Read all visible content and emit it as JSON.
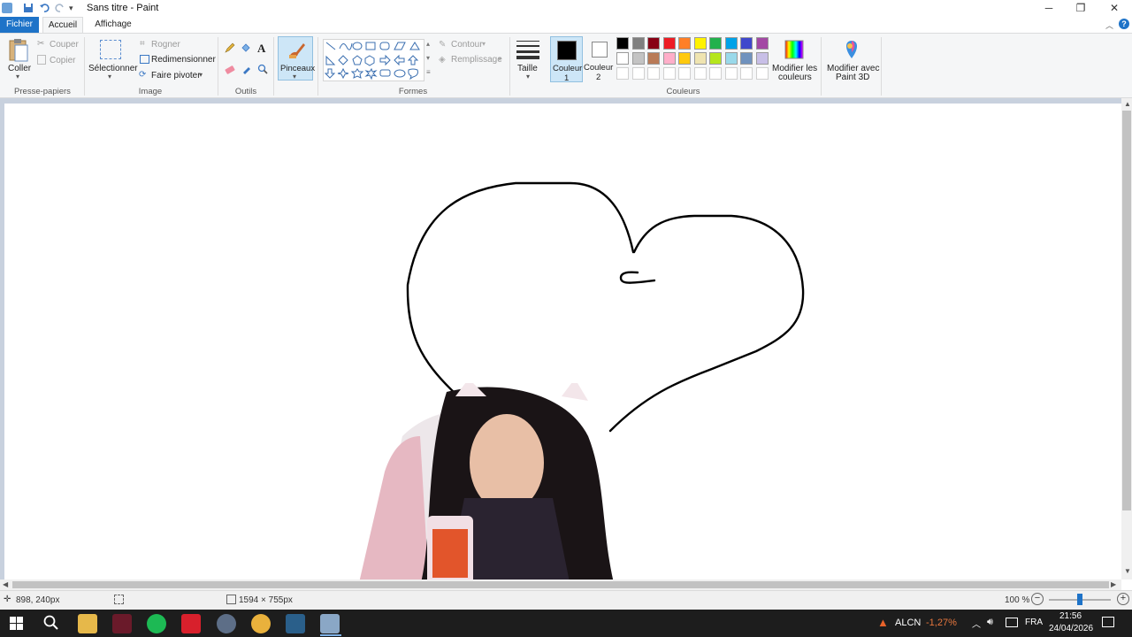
{
  "window": {
    "title": "Sans titre - Paint",
    "minimize_glyph": "─",
    "restore_glyph": "❐",
    "close_glyph": "✕"
  },
  "tabs": {
    "file": "Fichier",
    "home": "Accueil",
    "view": "Affichage"
  },
  "clipboard": {
    "paste": "Coller",
    "cut": "Couper",
    "copy": "Copier",
    "group": "Presse-papiers"
  },
  "image": {
    "select": "Sélectionner",
    "crop": "Rogner",
    "resize": "Redimensionner",
    "rotate": "Faire pivoter",
    "group": "Image"
  },
  "tools": {
    "group": "Outils",
    "brushes": "Pinceaux"
  },
  "shapes": {
    "outline": "Contour",
    "fill": "Remplissage",
    "group": "Formes"
  },
  "size": {
    "label": "Taille"
  },
  "colors": {
    "color1_line1": "Couleur",
    "color1_line2": "1",
    "color2_line1": "Couleur",
    "color2_line2": "2",
    "edit_colors_line1": "Modifier les",
    "edit_colors_line2": "couleurs",
    "edit_3d_line1": "Modifier avec",
    "edit_3d_line2": "Paint 3D",
    "group": "Couleurs",
    "color1": "#000000",
    "color2": "#ffffff",
    "palette_row1": [
      "#000000",
      "#7f7f7f",
      "#880015",
      "#ed1c24",
      "#ff7f27",
      "#fff200",
      "#22b14c",
      "#00a2e8",
      "#3f48cc",
      "#a349a4"
    ],
    "palette_row2": [
      "#ffffff",
      "#c3c3c3",
      "#b97a57",
      "#ffaec9",
      "#ffc90e",
      "#efe4b0",
      "#b5e61d",
      "#99d9ea",
      "#7092be",
      "#c8bfe7"
    ],
    "accent": "#1e73c8"
  },
  "status": {
    "cursor_pos": "898, 240px",
    "canvas_size": "1594 × 755px",
    "zoom": "100 %"
  },
  "taskbar": {
    "stock_name": "ALCN",
    "stock_change": "-1,27%",
    "language": "FRA",
    "time": "21:56",
    "date": "24/04/2026"
  }
}
